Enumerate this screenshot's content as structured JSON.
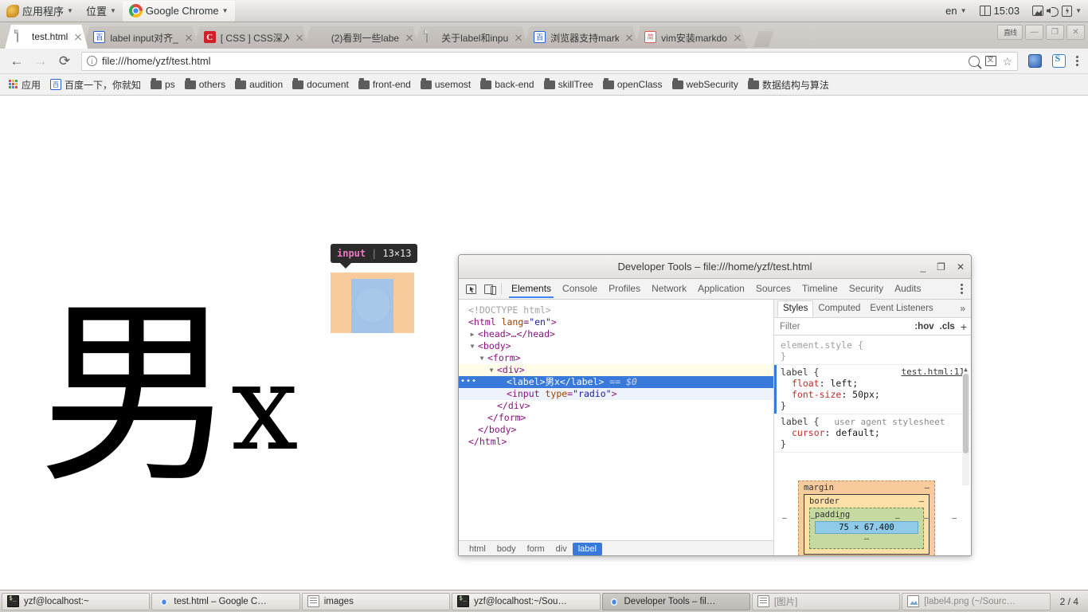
{
  "desktop_panel": {
    "applications_menu": "应用程序",
    "places_menu": "位置",
    "window_title": "Google Chrome",
    "keyboard_layout": "en",
    "clock": "15:03",
    "tray_icons": [
      "keyboard-icon",
      "display-icon",
      "volume-icon",
      "battery-icon"
    ]
  },
  "browser": {
    "tabs": [
      {
        "title": "test.html",
        "favicon": "page-icon",
        "active": true
      },
      {
        "title": "label input对齐_",
        "favicon": "baidu-icon",
        "active": false
      },
      {
        "title": "[ CSS ] CSS深入",
        "favicon": "csdn-icon",
        "active": false
      },
      {
        "title": "(2)看到一些labe",
        "favicon": "colorful-icon",
        "active": false
      },
      {
        "title": "关于label和inpu",
        "favicon": "page-icon",
        "active": false
      },
      {
        "title": "浏览器支持mark",
        "favicon": "baidu-icon",
        "active": false
      },
      {
        "title": "vim安装markdo",
        "favicon": "jianshu-icon",
        "active": false
      }
    ],
    "window_buttons": {
      "restore_label": "直线",
      "minimize": "—",
      "maximize": "❐",
      "close": "✕"
    },
    "nav": {
      "back": "←",
      "forward": "→",
      "reload": "⟳"
    },
    "omnibox": {
      "security_icon": "info-icon",
      "url": "file:///home/yzf/test.html",
      "right_icons": [
        "zoom-magnifier-icon",
        "translate-icon",
        "bookmark-star-icon"
      ]
    },
    "extension_icons": [
      "extension-icon-1",
      "extension-icon-2"
    ],
    "menu_icon": "kebab-menu-icon",
    "bookmarks": [
      {
        "label": "应用",
        "icon": "apps-grid-icon"
      },
      {
        "label": "百度一下，你就知",
        "icon": "baidu-icon"
      },
      {
        "label": "ps",
        "icon": "folder-icon"
      },
      {
        "label": "others",
        "icon": "folder-icon"
      },
      {
        "label": "audition",
        "icon": "folder-icon"
      },
      {
        "label": "document",
        "icon": "folder-icon"
      },
      {
        "label": "front-end",
        "icon": "folder-icon"
      },
      {
        "label": "usemost",
        "icon": "folder-icon"
      },
      {
        "label": "back-end",
        "icon": "folder-icon"
      },
      {
        "label": "skillTree",
        "icon": "folder-icon"
      },
      {
        "label": "openClass",
        "icon": "folder-icon"
      },
      {
        "label": "webSecurity",
        "icon": "folder-icon"
      },
      {
        "label": "数据结构与算法",
        "icon": "folder-icon"
      }
    ]
  },
  "page": {
    "label_cjk": "男",
    "label_latin": "x",
    "inspector_tooltip": {
      "tag": "input",
      "separator": "|",
      "dimensions": "13×13"
    },
    "highlight_colors": {
      "margin": "#f7cb9b",
      "content": "#a3c4e8"
    }
  },
  "devtools": {
    "title": "Developer Tools – file:///home/yzf/test.html",
    "window_buttons": {
      "minimize": "_",
      "maximize": "❐",
      "close": "✕"
    },
    "toolbar_icons": [
      "inspect-element-icon",
      "device-toolbar-icon"
    ],
    "panels": [
      "Elements",
      "Console",
      "Profiles",
      "Network",
      "Application",
      "Sources",
      "Timeline",
      "Security",
      "Audits"
    ],
    "active_panel": "Elements",
    "more_icon": "kebab-menu-icon",
    "dom_tree": [
      {
        "indent": 0,
        "arrow": "",
        "kind": "doctype",
        "text": "<!DOCTYPE html>"
      },
      {
        "indent": 0,
        "arrow": "",
        "kind": "open",
        "tag": "html",
        "attr": "lang",
        "value": "\"en\""
      },
      {
        "indent": 1,
        "arrow": "▶",
        "kind": "collapsed",
        "text": "<head>…</head>"
      },
      {
        "indent": 1,
        "arrow": "▼",
        "kind": "open",
        "tag": "body"
      },
      {
        "indent": 2,
        "arrow": "▼",
        "kind": "open",
        "tag": "form"
      },
      {
        "indent": 3,
        "arrow": "▼",
        "kind": "open",
        "tag": "div",
        "hovered": true
      },
      {
        "indent": 4,
        "arrow": "",
        "kind": "selected",
        "text": "<label>男x</label>",
        "suffix": "== $0"
      },
      {
        "indent": 4,
        "arrow": "",
        "kind": "childsel",
        "text": "<input type=\"radio\">"
      },
      {
        "indent": 3,
        "arrow": "",
        "kind": "close",
        "text": "</div>"
      },
      {
        "indent": 2,
        "arrow": "",
        "kind": "close",
        "text": "</form>"
      },
      {
        "indent": 1,
        "arrow": "",
        "kind": "close",
        "text": "</body>"
      },
      {
        "indent": 0,
        "arrow": "",
        "kind": "close",
        "text": "</html>"
      }
    ],
    "breadcrumbs": [
      "html",
      "body",
      "form",
      "div",
      "label"
    ],
    "breadcrumb_selected": "label",
    "styles_pane": {
      "tabs": [
        "Styles",
        "Computed",
        "Event Listeners"
      ],
      "active_tab": "Styles",
      "more": "»",
      "filter_placeholder": "Filter",
      "filter_value": "",
      "toggles": [
        ":hov",
        ".cls"
      ],
      "new_rule": "+",
      "rules": [
        {
          "selector": "element.style",
          "source": "",
          "declarations": []
        },
        {
          "selector": "label",
          "source": "test.html:11",
          "declarations": [
            {
              "name": "float",
              "value": "left"
            },
            {
              "name": "font-size",
              "value": "50px"
            }
          ]
        },
        {
          "selector": "label",
          "source": "user agent stylesheet",
          "declarations": [
            {
              "name": "cursor",
              "value": "default"
            }
          ]
        }
      ],
      "box_model": {
        "margin_label": "margin",
        "margin_value": "–",
        "border_label": "border",
        "border_value": "–",
        "padding_label": "padding",
        "padding_value": "–",
        "content_size": "75 × 67.400"
      }
    }
  },
  "taskbar": {
    "items": [
      {
        "label": "yzf@localhost:~",
        "icon": "terminal-icon",
        "state": "normal"
      },
      {
        "label": "test.html – Google C…",
        "icon": "chrome-icon",
        "state": "normal"
      },
      {
        "label": "images",
        "icon": "files-icon",
        "state": "normal"
      },
      {
        "label": "yzf@localhost:~/Sou…",
        "icon": "terminal-icon",
        "state": "normal"
      },
      {
        "label": "Developer Tools – fil…",
        "icon": "chrome-icon",
        "state": "active"
      },
      {
        "label": "[图片]",
        "icon": "files-icon",
        "state": "dim"
      },
      {
        "label": "[label4.png (~/Sourc…",
        "icon": "image-icon",
        "state": "dim"
      }
    ],
    "workspace_indicator": "2 / 4"
  }
}
